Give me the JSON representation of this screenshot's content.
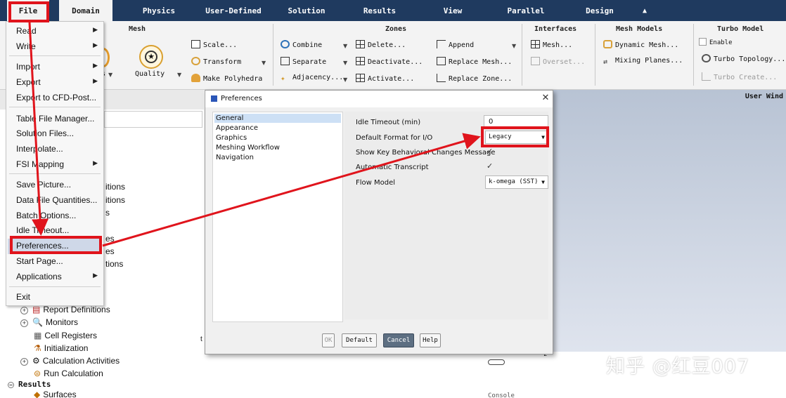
{
  "menubar": {
    "tabs": [
      "File",
      "Domain",
      "Physics",
      "User-Defined",
      "Solution",
      "Results",
      "View",
      "Parallel",
      "Design"
    ],
    "collapse_icon": "caret-up-icon"
  },
  "ribbon": {
    "mesh": {
      "title": "Mesh",
      "quality": "Quality",
      "scale": "Scale...",
      "transform": "Transform",
      "polyhedra": "Make Polyhedra",
      "display_arrow": "s"
    },
    "zones": {
      "title": "Zones",
      "combine": "Combine",
      "separate": "Separate",
      "adjacency": "Adjacency...",
      "delete": "Delete...",
      "deactivate": "Deactivate...",
      "activate": "Activate...",
      "append": "Append",
      "replace_mesh": "Replace Mesh...",
      "replace_zone": "Replace Zone..."
    },
    "interfaces": {
      "title": "Interfaces",
      "mesh": "Mesh...",
      "overset": "Overset..."
    },
    "mesh_models": {
      "title": "Mesh Models",
      "dynamic": "Dynamic Mesh...",
      "mixing": "Mixing Planes..."
    },
    "turbo": {
      "title": "Turbo Model",
      "enable": "Enable",
      "topology": "Turbo Topology...",
      "create": "Turbo Create..."
    }
  },
  "file_menu": {
    "items": [
      "Read",
      "Write",
      "Import",
      "Export",
      "Export to CFD-Post...",
      "Table File Manager...",
      "Solution Files...",
      "Interpolate...",
      "FSI Mapping",
      "Save Picture...",
      "Data File Quantities...",
      "Batch Options...",
      "Idle Timeout...",
      "Preferences...",
      "Start Page...",
      "Applications",
      "Exit"
    ],
    "highlighted": "Preferences..."
  },
  "tree": {
    "partial": [
      "itions",
      "itions",
      "s",
      "es",
      "es",
      "tions"
    ],
    "items": [
      "Report Definitions",
      "Monitors",
      "Cell Registers",
      "Initialization",
      "Calculation Activities",
      "Run Calculation"
    ],
    "results_label": "Results",
    "surfaces": "Surfaces",
    "stray": "t"
  },
  "graphics": {
    "label": "User Wind"
  },
  "console": {
    "label": "Console",
    "stray": "z"
  },
  "dialog": {
    "title": "Preferences",
    "nav": [
      "General",
      "Appearance",
      "Graphics",
      "Meshing Workflow",
      "Navigation"
    ],
    "selected_nav": "General",
    "fields": {
      "idle_timeout_label": "Idle Timeout (min)",
      "idle_timeout_value": "0",
      "io_format_label": "Default Format for I/O",
      "io_format_value": "Legacy",
      "key_changes_label": "Show Key Behavioral Changes Message",
      "key_changes_checked": "✓",
      "transcript_label": "Automatic Transcript",
      "transcript_checked": "✓",
      "flow_model_label": "Flow Model",
      "flow_model_value": "k-omega (SST)"
    },
    "buttons": {
      "ok": "OK",
      "default": "Default",
      "cancel": "Cancel",
      "help": "Help"
    }
  },
  "watermark": "知乎 @红豆007",
  "colors": {
    "highlight": "#e0141c",
    "menubar": "#1f3a5f",
    "dialog_bg": "#f0f0f0"
  }
}
